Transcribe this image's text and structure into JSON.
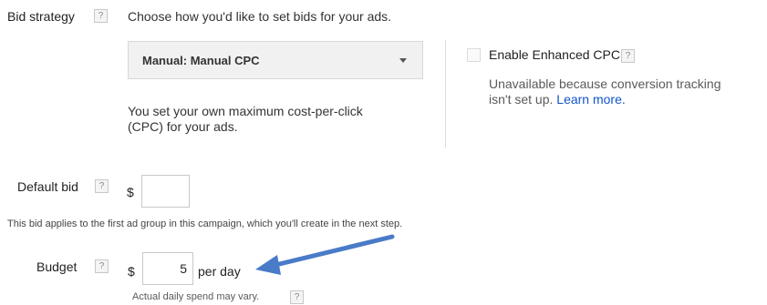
{
  "bid_strategy": {
    "label": "Bid strategy",
    "prompt": "Choose how you'd like to set bids for your ads.",
    "selected": "Manual: Manual CPC",
    "description_line1": "You set your own maximum cost-per-click",
    "description_line2": "(CPC) for your ads."
  },
  "enhanced_cpc": {
    "label": "Enable Enhanced CPC",
    "note_line1": "Unavailable because conversion tracking",
    "note_line2": "isn't set up.",
    "link": "Learn more."
  },
  "default_bid": {
    "label": "Default bid",
    "currency": "$",
    "value": "",
    "note": "This bid applies to the first ad group in this campaign, which you'll create in the next step."
  },
  "budget": {
    "label": "Budget",
    "currency": "$",
    "value": "5",
    "unit": "per day",
    "note": "Actual daily spend may vary."
  },
  "help_glyph": "?",
  "colors": {
    "link": "#1155cc",
    "arrow": "#4a7bc8",
    "select_bg": "#f1f1f1",
    "muted_text": "#5a5a5a"
  },
  "icons": [
    "help-icon",
    "dropdown-caret-icon",
    "arrow-annotation-icon"
  ]
}
